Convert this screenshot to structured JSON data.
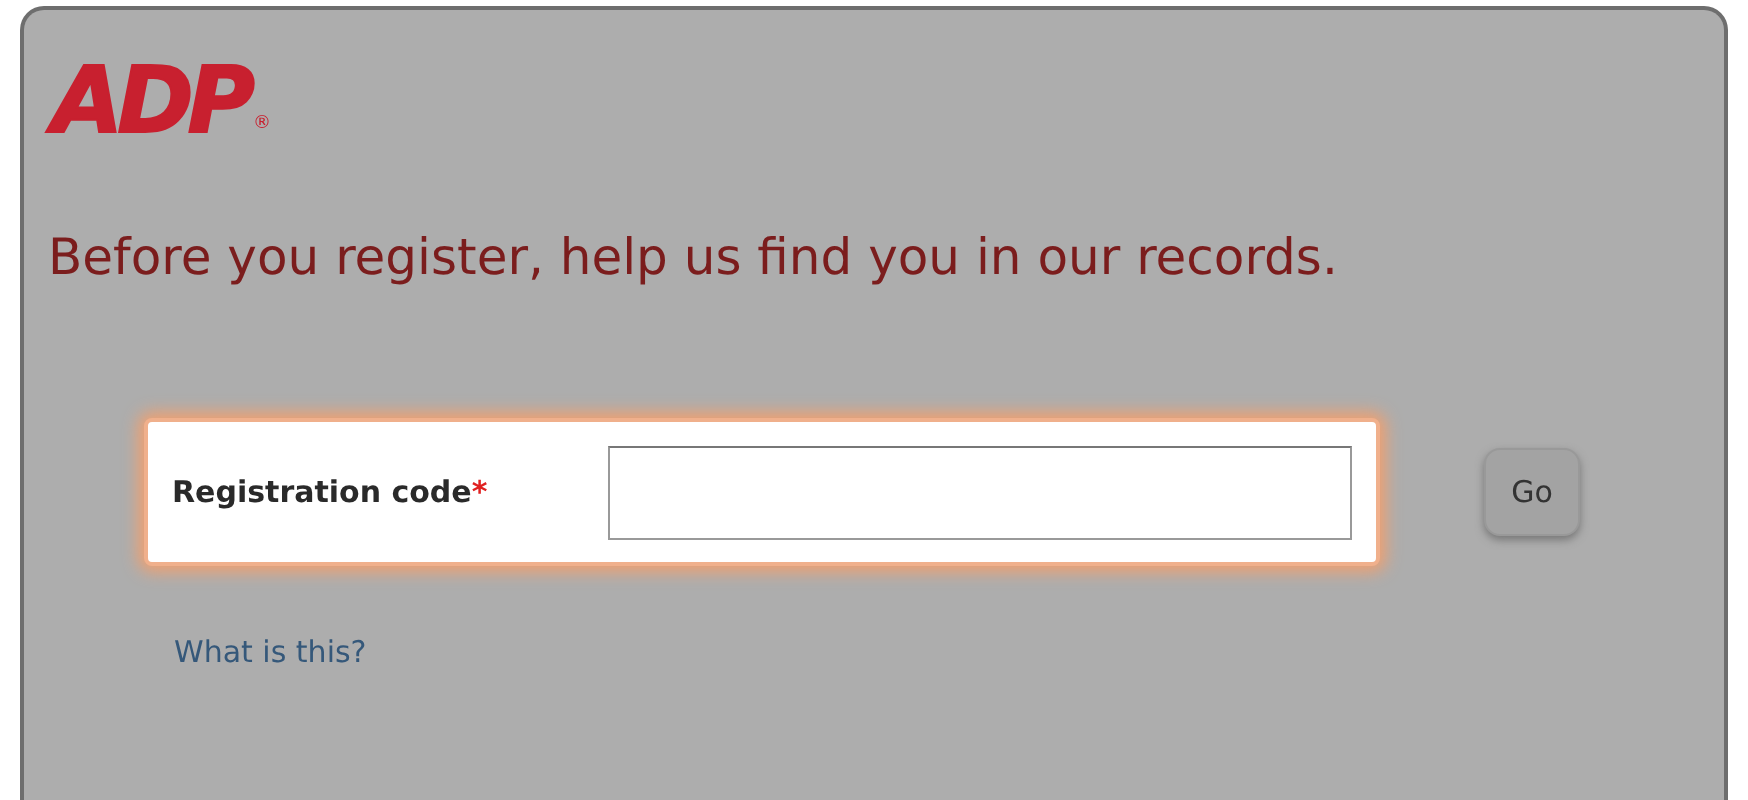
{
  "logo": {
    "text": "ADP",
    "mark": "®"
  },
  "heading": "Before you register, help us find you in our records.",
  "field": {
    "label": "Registration code",
    "required_mark": "*"
  },
  "go_button": "Go",
  "help_link": "What is this?"
}
